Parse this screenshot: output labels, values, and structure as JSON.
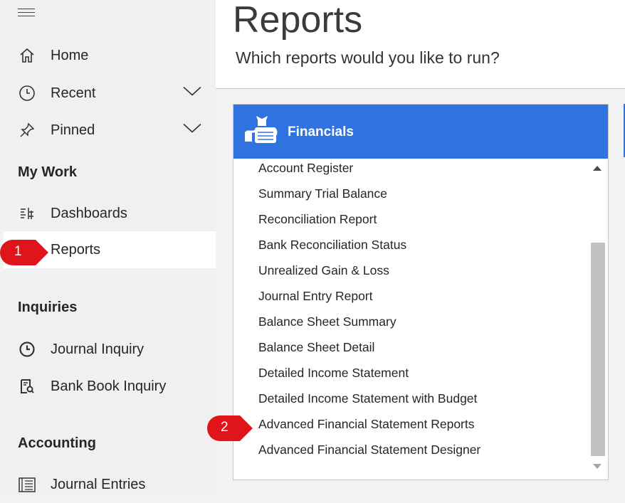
{
  "sidebar": {
    "nav": {
      "home": "Home",
      "recent": "Recent",
      "pinned": "Pinned"
    },
    "my_work": {
      "title": "My Work",
      "dashboards": "Dashboards",
      "reports": "Reports"
    },
    "inquiries": {
      "title": "Inquiries",
      "journal_inquiry": "Journal Inquiry",
      "bank_book_inquiry": "Bank Book Inquiry"
    },
    "accounting": {
      "title": "Accounting",
      "journal_entries": "Journal Entries"
    }
  },
  "header": {
    "title": "Reports",
    "subtitle": "Which reports would you like to run?"
  },
  "card": {
    "title": "Financials",
    "items": [
      "Account Register",
      "Summary Trial Balance",
      "Reconciliation Report",
      "Bank Reconciliation Status",
      "Unrealized Gain & Loss",
      "Journal Entry Report",
      "Balance Sheet Summary",
      "Balance Sheet Detail",
      "Detailed Income Statement",
      "Detailed Income Statement with Budget",
      "Advanced Financial Statement Reports",
      "Advanced Financial Statement Designer"
    ]
  },
  "callouts": {
    "one": "1",
    "two": "2"
  },
  "colors": {
    "accent": "#2f73e0",
    "callout": "#e0141b"
  }
}
